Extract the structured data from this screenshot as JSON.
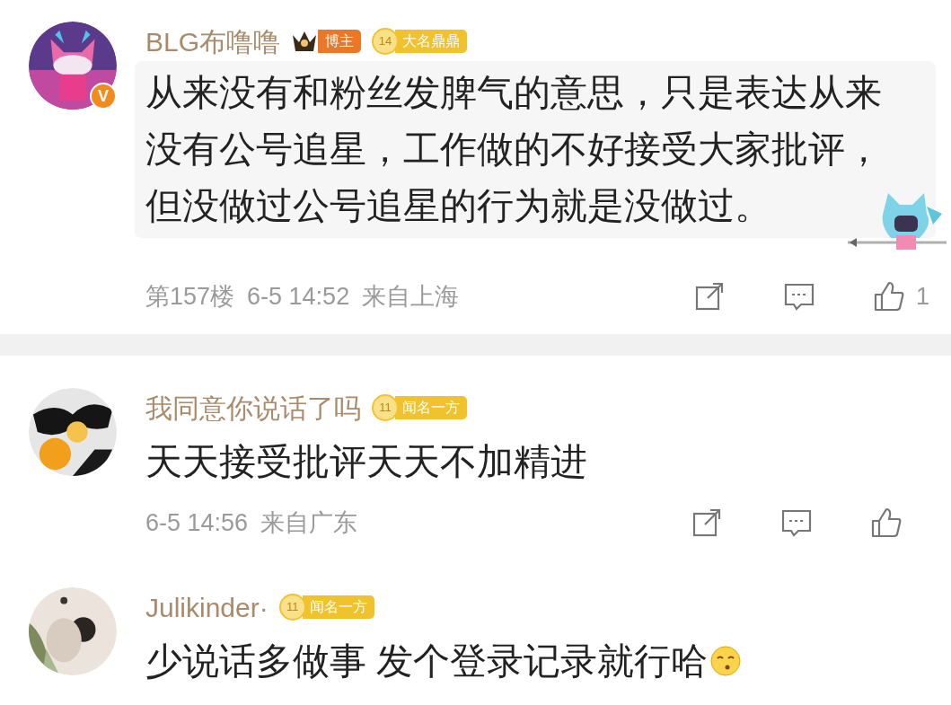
{
  "comments": [
    {
      "avatar": {
        "kind": "picture",
        "verified_mark": "V"
      },
      "name": "BLG布噜噜",
      "badges": [
        {
          "kind": "role",
          "label": "博主"
        },
        {
          "kind": "fan",
          "level": "14",
          "label": "大名鼎鼎"
        }
      ],
      "bubble": true,
      "sticker": true,
      "content": "从来没有和粉丝发脾气的意思，只是表达从来没有公号追星，工作做的不好接受大家批评，但没做过公号追星的行为就是没做过。",
      "emoji": false,
      "footer": {
        "floor": "第157楼",
        "time": "6-5 14:52",
        "location": "来自上海",
        "like_count": "1"
      },
      "section_break": true
    },
    {
      "avatar": {
        "kind": "picture"
      },
      "name": "我同意你说话了吗",
      "badges": [
        {
          "kind": "fan",
          "level": "11",
          "label": "闻名一方"
        }
      ],
      "bubble": false,
      "sticker": false,
      "content": "天天接受批评天天不加精进",
      "emoji": false,
      "footer": {
        "time": "6-5 14:56",
        "location": "来自广东"
      },
      "section_break": false
    },
    {
      "avatar": {
        "kind": "picture"
      },
      "name": "Julikinder·",
      "badges": [
        {
          "kind": "fan",
          "level": "11",
          "label": "闻名一方"
        }
      ],
      "bubble": false,
      "sticker": false,
      "content": "少说话多做事 发个登录记录就行哈",
      "emoji": true,
      "section_break": false
    }
  ]
}
